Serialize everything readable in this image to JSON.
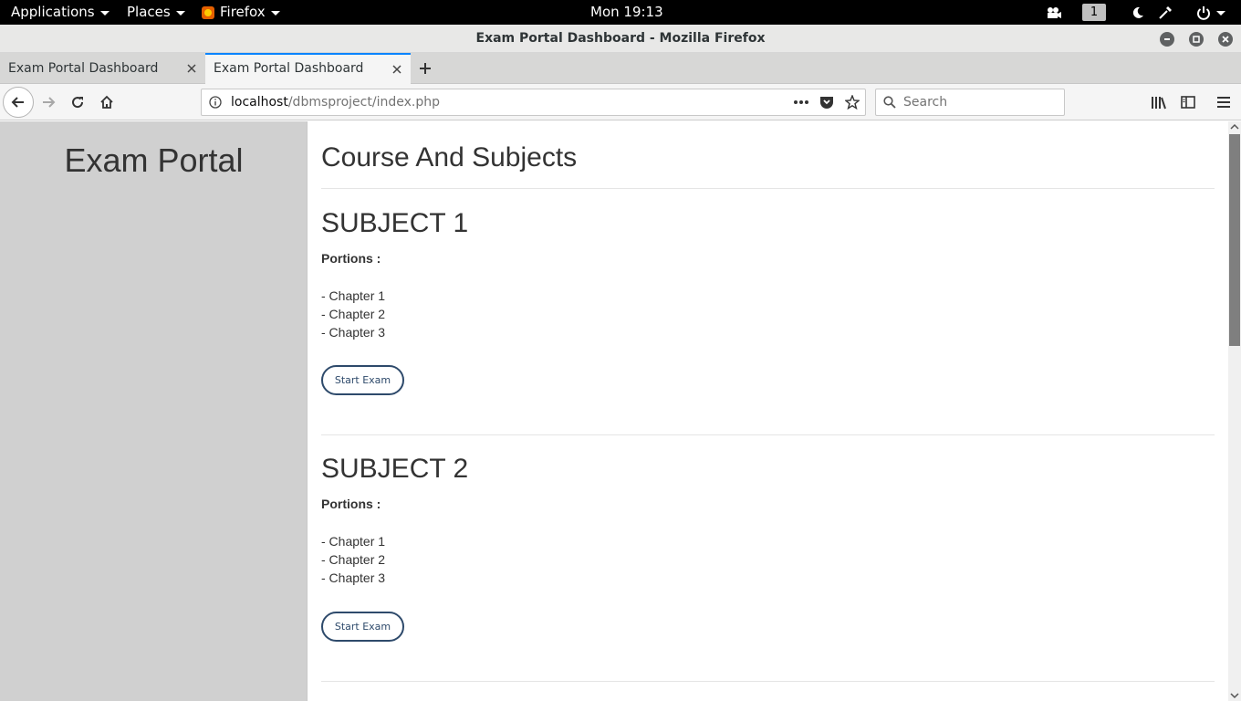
{
  "topbar": {
    "applications_label": "Applications",
    "places_label": "Places",
    "app_label": "Firefox",
    "clock": "Mon 19:13",
    "workspace_number": "1"
  },
  "window": {
    "title": "Exam Portal Dashboard - Mozilla Firefox"
  },
  "tabs": [
    {
      "label": "Exam Portal Dashboard",
      "active": false
    },
    {
      "label": "Exam Portal Dashboard",
      "active": true
    }
  ],
  "navbar": {
    "url_host": "localhost",
    "url_path": "/dbmsproject/index.php",
    "search_placeholder": "Search"
  },
  "page": {
    "site_title": "Exam Portal",
    "heading": "Course And Subjects",
    "subjects": [
      {
        "title": "SUBJECT 1",
        "portions_label": "Portions :",
        "chapters": [
          "- Chapter 1",
          "- Chapter 2",
          "- Chapter 3"
        ],
        "button_label": "Start Exam"
      },
      {
        "title": "SUBJECT 2",
        "portions_label": "Portions :",
        "chapters": [
          "- Chapter 1",
          "- Chapter 2",
          "- Chapter 3"
        ],
        "button_label": "Start Exam"
      }
    ]
  },
  "colors": {
    "accent_tab": "#0a84ff",
    "sidebar_bg": "#d0d0d0",
    "button_border": "#2e4a6b"
  }
}
